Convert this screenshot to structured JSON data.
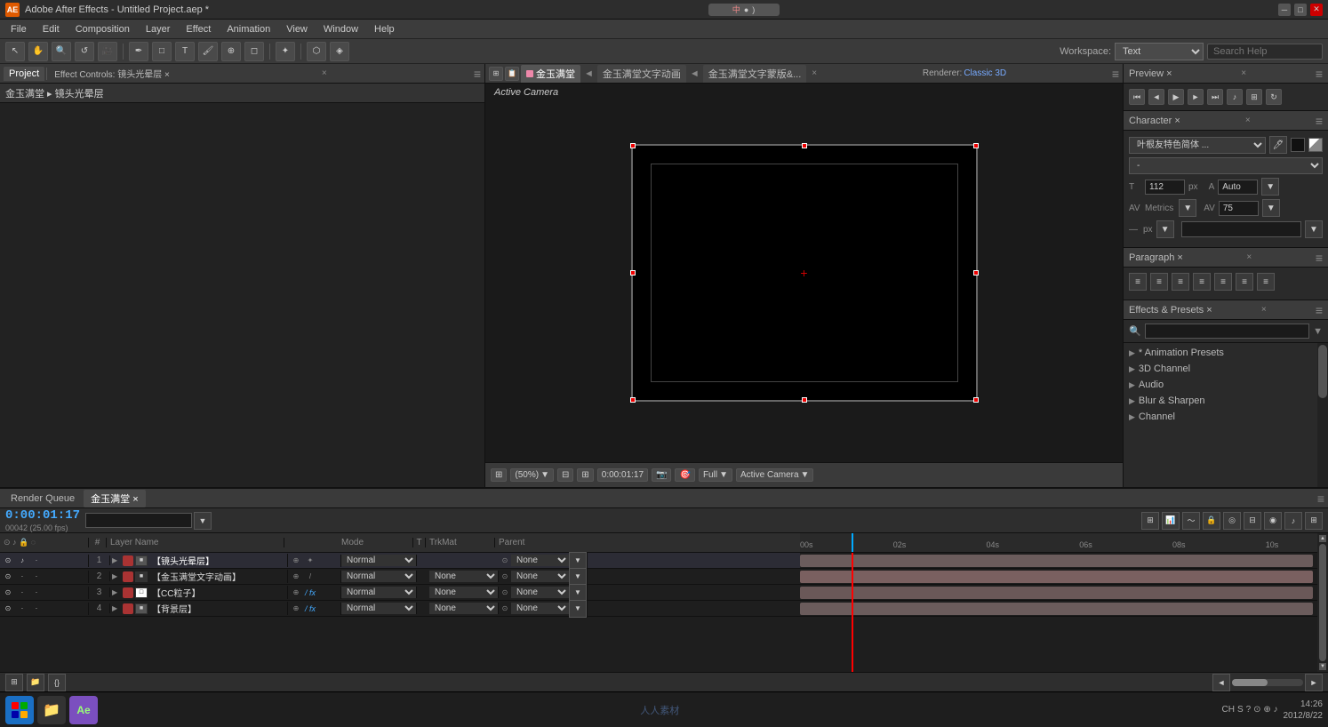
{
  "titleBar": {
    "title": "Adobe After Effects - Untitled Project.aep *",
    "icon": "AE"
  },
  "menuBar": {
    "items": [
      "File",
      "Edit",
      "Composition",
      "Layer",
      "Effect",
      "Animation",
      "View",
      "Window",
      "Help"
    ]
  },
  "workspace": {
    "label": "Workspace:",
    "value": "Text",
    "searchPlaceholder": "Search Help"
  },
  "panels": {
    "project": {
      "tab": "Project",
      "breadcrumb": "金玉满堂 ▸ 镜头光晕层"
    },
    "effectControls": {
      "tab": "Effect Controls: 镜头光晕层 ×"
    },
    "composition": {
      "title": "Composition: 金玉满堂 ×",
      "tabs": [
        "金玉满堂",
        "金玉满堂文字动画",
        "金玉满堂文字蒙版&..."
      ],
      "activeCamera": "Active Camera",
      "renderer": "Renderer:",
      "rendererValue": "Classic 3D"
    },
    "preview": {
      "tab": "Preview ×"
    },
    "character": {
      "tab": "Character ×",
      "fontName": "叶根友特色简体 ...",
      "fontStyle": "-",
      "fontSize": "112 px",
      "tracking": "Auto",
      "metrics": "Metrics",
      "metricsValue": "75",
      "unit": "px"
    },
    "paragraph": {
      "tab": "Paragraph ×"
    },
    "effectsPresets": {
      "tab": "Effects & Presets ×",
      "categories": [
        "* Animation Presets",
        "3D Channel",
        "Audio",
        "Blur & Sharpen",
        "Channel"
      ]
    }
  },
  "timeline": {
    "tabs": [
      "Render Queue",
      "金玉满堂 ×"
    ],
    "timecode": "0:00:01:17",
    "frameInfo": "00042 (25.00 fps)",
    "layers": [
      {
        "num": "1",
        "color": "#aa3333",
        "name": "【镜头光晕层】",
        "hasFx": false,
        "mode": "Normal",
        "trkmat": "",
        "parent": "None",
        "switches": []
      },
      {
        "num": "2",
        "color": "#aa3333",
        "name": "【金玉满堂文字动画】",
        "hasFx": false,
        "mode": "Normal",
        "trkmat": "None",
        "parent": "None",
        "switches": []
      },
      {
        "num": "3",
        "color": "#aa3333",
        "name": "【CC粒子】",
        "hasFx": true,
        "mode": "Normal",
        "trkmat": "None",
        "parent": "None",
        "switches": []
      },
      {
        "num": "4",
        "color": "#aa3333",
        "name": "【背景层】",
        "hasFx": true,
        "mode": "Normal",
        "trkmat": "None",
        "parent": "None",
        "switches": []
      }
    ],
    "timeMarkers": [
      "00s",
      "02s",
      "04s",
      "06s",
      "08s",
      "10s"
    ],
    "cursorPos": "10%"
  },
  "bottomBar": {
    "icons": [
      "home-icon",
      "folder-icon",
      "code-icon"
    ]
  },
  "statusBar": {
    "items": []
  },
  "taskbar": {
    "time": "14:26",
    "date": "2012/8/22",
    "appName": "AE"
  },
  "compBottomBar": {
    "zoom": "(50%)",
    "timecode": "0:00:01:17",
    "quality": "Full",
    "view": "Active Camera"
  }
}
